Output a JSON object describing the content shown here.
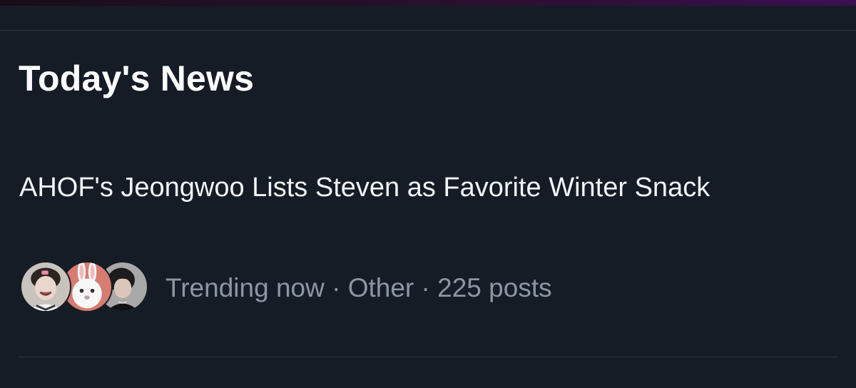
{
  "section": {
    "title": "Today's News"
  },
  "news_item": {
    "headline": "AHOF's Jeongwoo Lists Steven as Favorite Winter Snack",
    "meta": {
      "status": "Trending now",
      "separator": " · ",
      "category": "Other",
      "post_count": "225 posts"
    },
    "avatars": [
      {
        "icon": "avatar-person-smiling"
      },
      {
        "icon": "avatar-white-rabbit"
      },
      {
        "icon": "avatar-person-dark-hair"
      }
    ]
  },
  "colors": {
    "background": "#151c26",
    "title_text": "#ffffff",
    "headline_text": "#f2f4f6",
    "meta_text": "#8b97a5",
    "divider": "#2d3641"
  }
}
